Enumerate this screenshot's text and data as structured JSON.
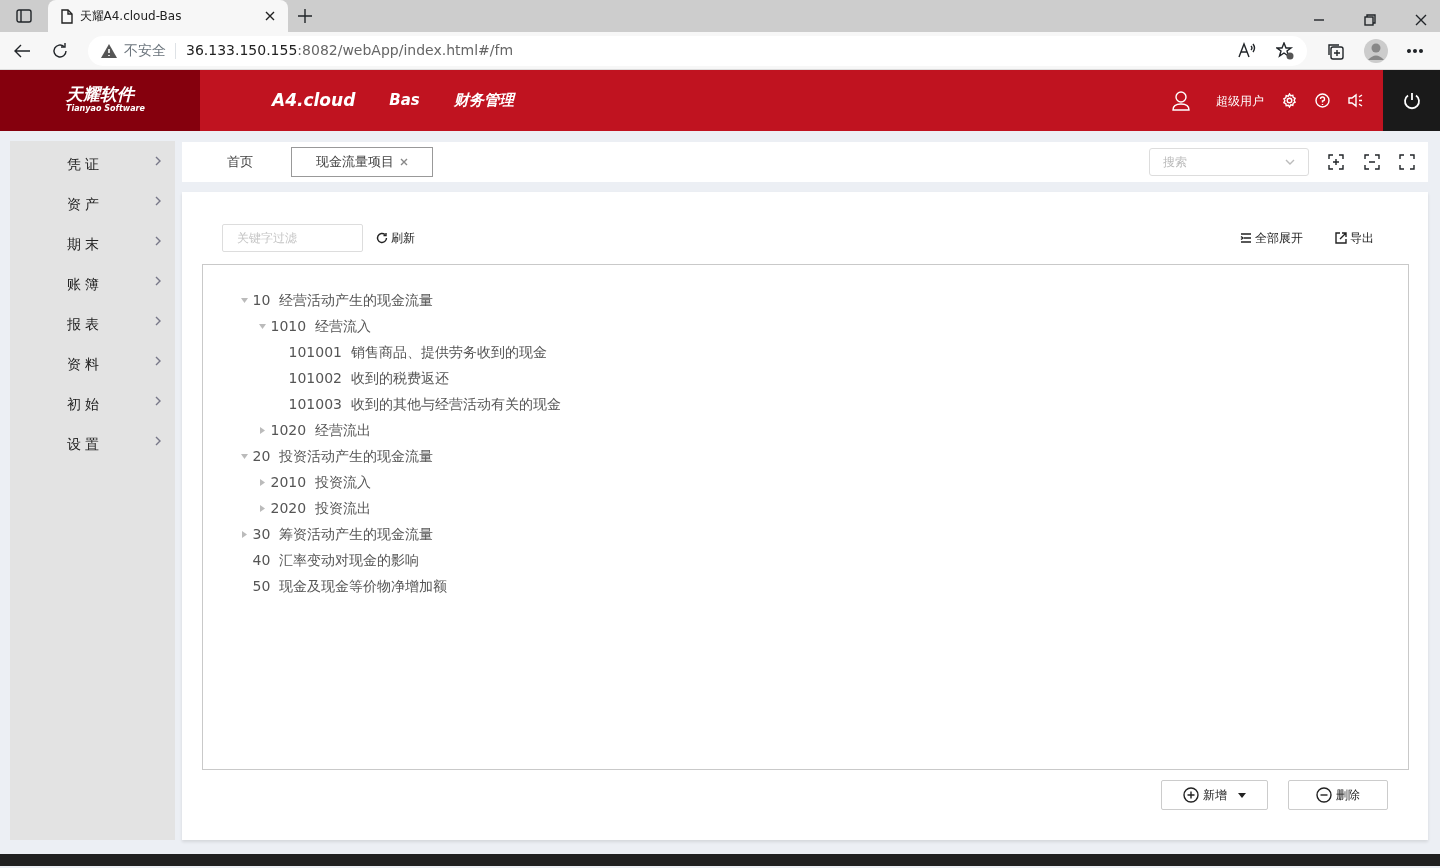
{
  "browser": {
    "tab_title": "天耀A4.cloud-Bas",
    "security": "不安全",
    "url_host": "36.133.150.155",
    "url_rest": ":8082/webApp/index.html#/fm"
  },
  "header": {
    "logo": "天耀软件",
    "logo_sub": "Tianyao Software",
    "nav": [
      "A4.cloud",
      "Bas",
      "财务管理"
    ],
    "user": "超级用户"
  },
  "sidebar": {
    "items": [
      {
        "label": "凭 证"
      },
      {
        "label": "资 产"
      },
      {
        "label": "期 末"
      },
      {
        "label": "账 簿"
      },
      {
        "label": "报 表"
      },
      {
        "label": "资 料"
      },
      {
        "label": "初 始"
      },
      {
        "label": "设 置"
      }
    ]
  },
  "tabs": [
    {
      "label": "首页",
      "selected": false,
      "closable": false
    },
    {
      "label": "现金流量项目",
      "selected": true,
      "closable": true
    }
  ],
  "tab_search": {
    "placeholder": "搜索"
  },
  "toolbar": {
    "filter_placeholder": "关键字过滤",
    "refresh": "刷新",
    "expand_all": "全部展开",
    "export": "导出"
  },
  "tree": [
    {
      "code": "10",
      "name": "经营活动产生的现金流量",
      "expanded": true,
      "children": [
        {
          "code": "1010",
          "name": "经营流入",
          "expanded": true,
          "children": [
            {
              "code": "101001",
              "name": "销售商品、提供劳务收到的现金"
            },
            {
              "code": "101002",
              "name": "收到的税费返还"
            },
            {
              "code": "101003",
              "name": "收到的其他与经营活动有关的现金"
            }
          ]
        },
        {
          "code": "1020",
          "name": "经营流出",
          "expanded": false
        }
      ]
    },
    {
      "code": "20",
      "name": "投资活动产生的现金流量",
      "expanded": true,
      "children": [
        {
          "code": "2010",
          "name": "投资流入",
          "expanded": false
        },
        {
          "code": "2020",
          "name": "投资流出",
          "expanded": false
        }
      ]
    },
    {
      "code": "30",
      "name": "筹资活动产生的现金流量",
      "expanded": false
    },
    {
      "code": "40",
      "name": "汇率变动对现金的影响"
    },
    {
      "code": "50",
      "name": "现金及现金等价物净增加额"
    }
  ],
  "buttons": {
    "add": "新增",
    "delete": "删除"
  }
}
